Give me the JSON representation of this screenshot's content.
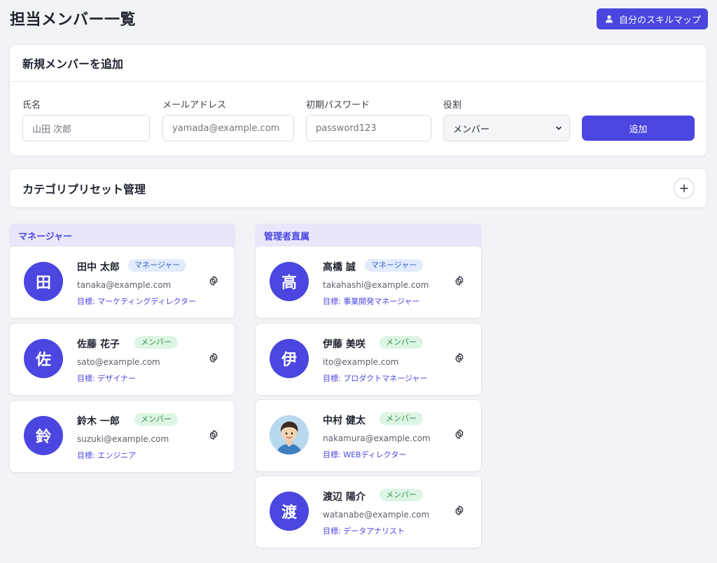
{
  "header": {
    "title": "担当メンバー一覧",
    "skillmap_label": "自分のスキルマップ"
  },
  "add_member": {
    "title": "新規メンバーを追加",
    "name_label": "氏名",
    "name_placeholder": "山田 次郎",
    "email_label": "メールアドレス",
    "email_placeholder": "yamada@example.com",
    "password_label": "初期パスワード",
    "password_placeholder": "password123",
    "role_label": "役割",
    "role_selected": "メンバー",
    "add_label": "追加"
  },
  "presets": {
    "title": "カテゴリプリセット管理"
  },
  "groups": [
    {
      "title": "マネージャー",
      "members": [
        {
          "initial": "田",
          "name": "田中 太郎",
          "role": "マネージャー",
          "email": "tanaka@example.com",
          "goal": "目標: マーケティングディレクター"
        },
        {
          "initial": "佐",
          "name": "佐藤 花子",
          "role": "メンバー",
          "email": "sato@example.com",
          "goal": "目標: デザイナー"
        },
        {
          "initial": "鈴",
          "name": "鈴木 一郎",
          "role": "メンバー",
          "email": "suzuki@example.com",
          "goal": "目標: エンジニア"
        }
      ]
    },
    {
      "title": "管理者直属",
      "members": [
        {
          "initial": "高",
          "name": "高橋 誠",
          "role": "マネージャー",
          "email": "takahashi@example.com",
          "goal": "目標: 事業開発マネージャー"
        },
        {
          "initial": "伊",
          "name": "伊藤 美咲",
          "role": "メンバー",
          "email": "ito@example.com",
          "goal": "目標: プロダクトマネージャー"
        },
        {
          "initial": "",
          "name": "中村 健太",
          "role": "メンバー",
          "email": "nakamura@example.com",
          "goal": "目標: WEBディレクター"
        },
        {
          "initial": "渡",
          "name": "渡辺 陽介",
          "role": "メンバー",
          "email": "watanabe@example.com",
          "goal": "目標: データアナリスト"
        }
      ]
    }
  ]
}
